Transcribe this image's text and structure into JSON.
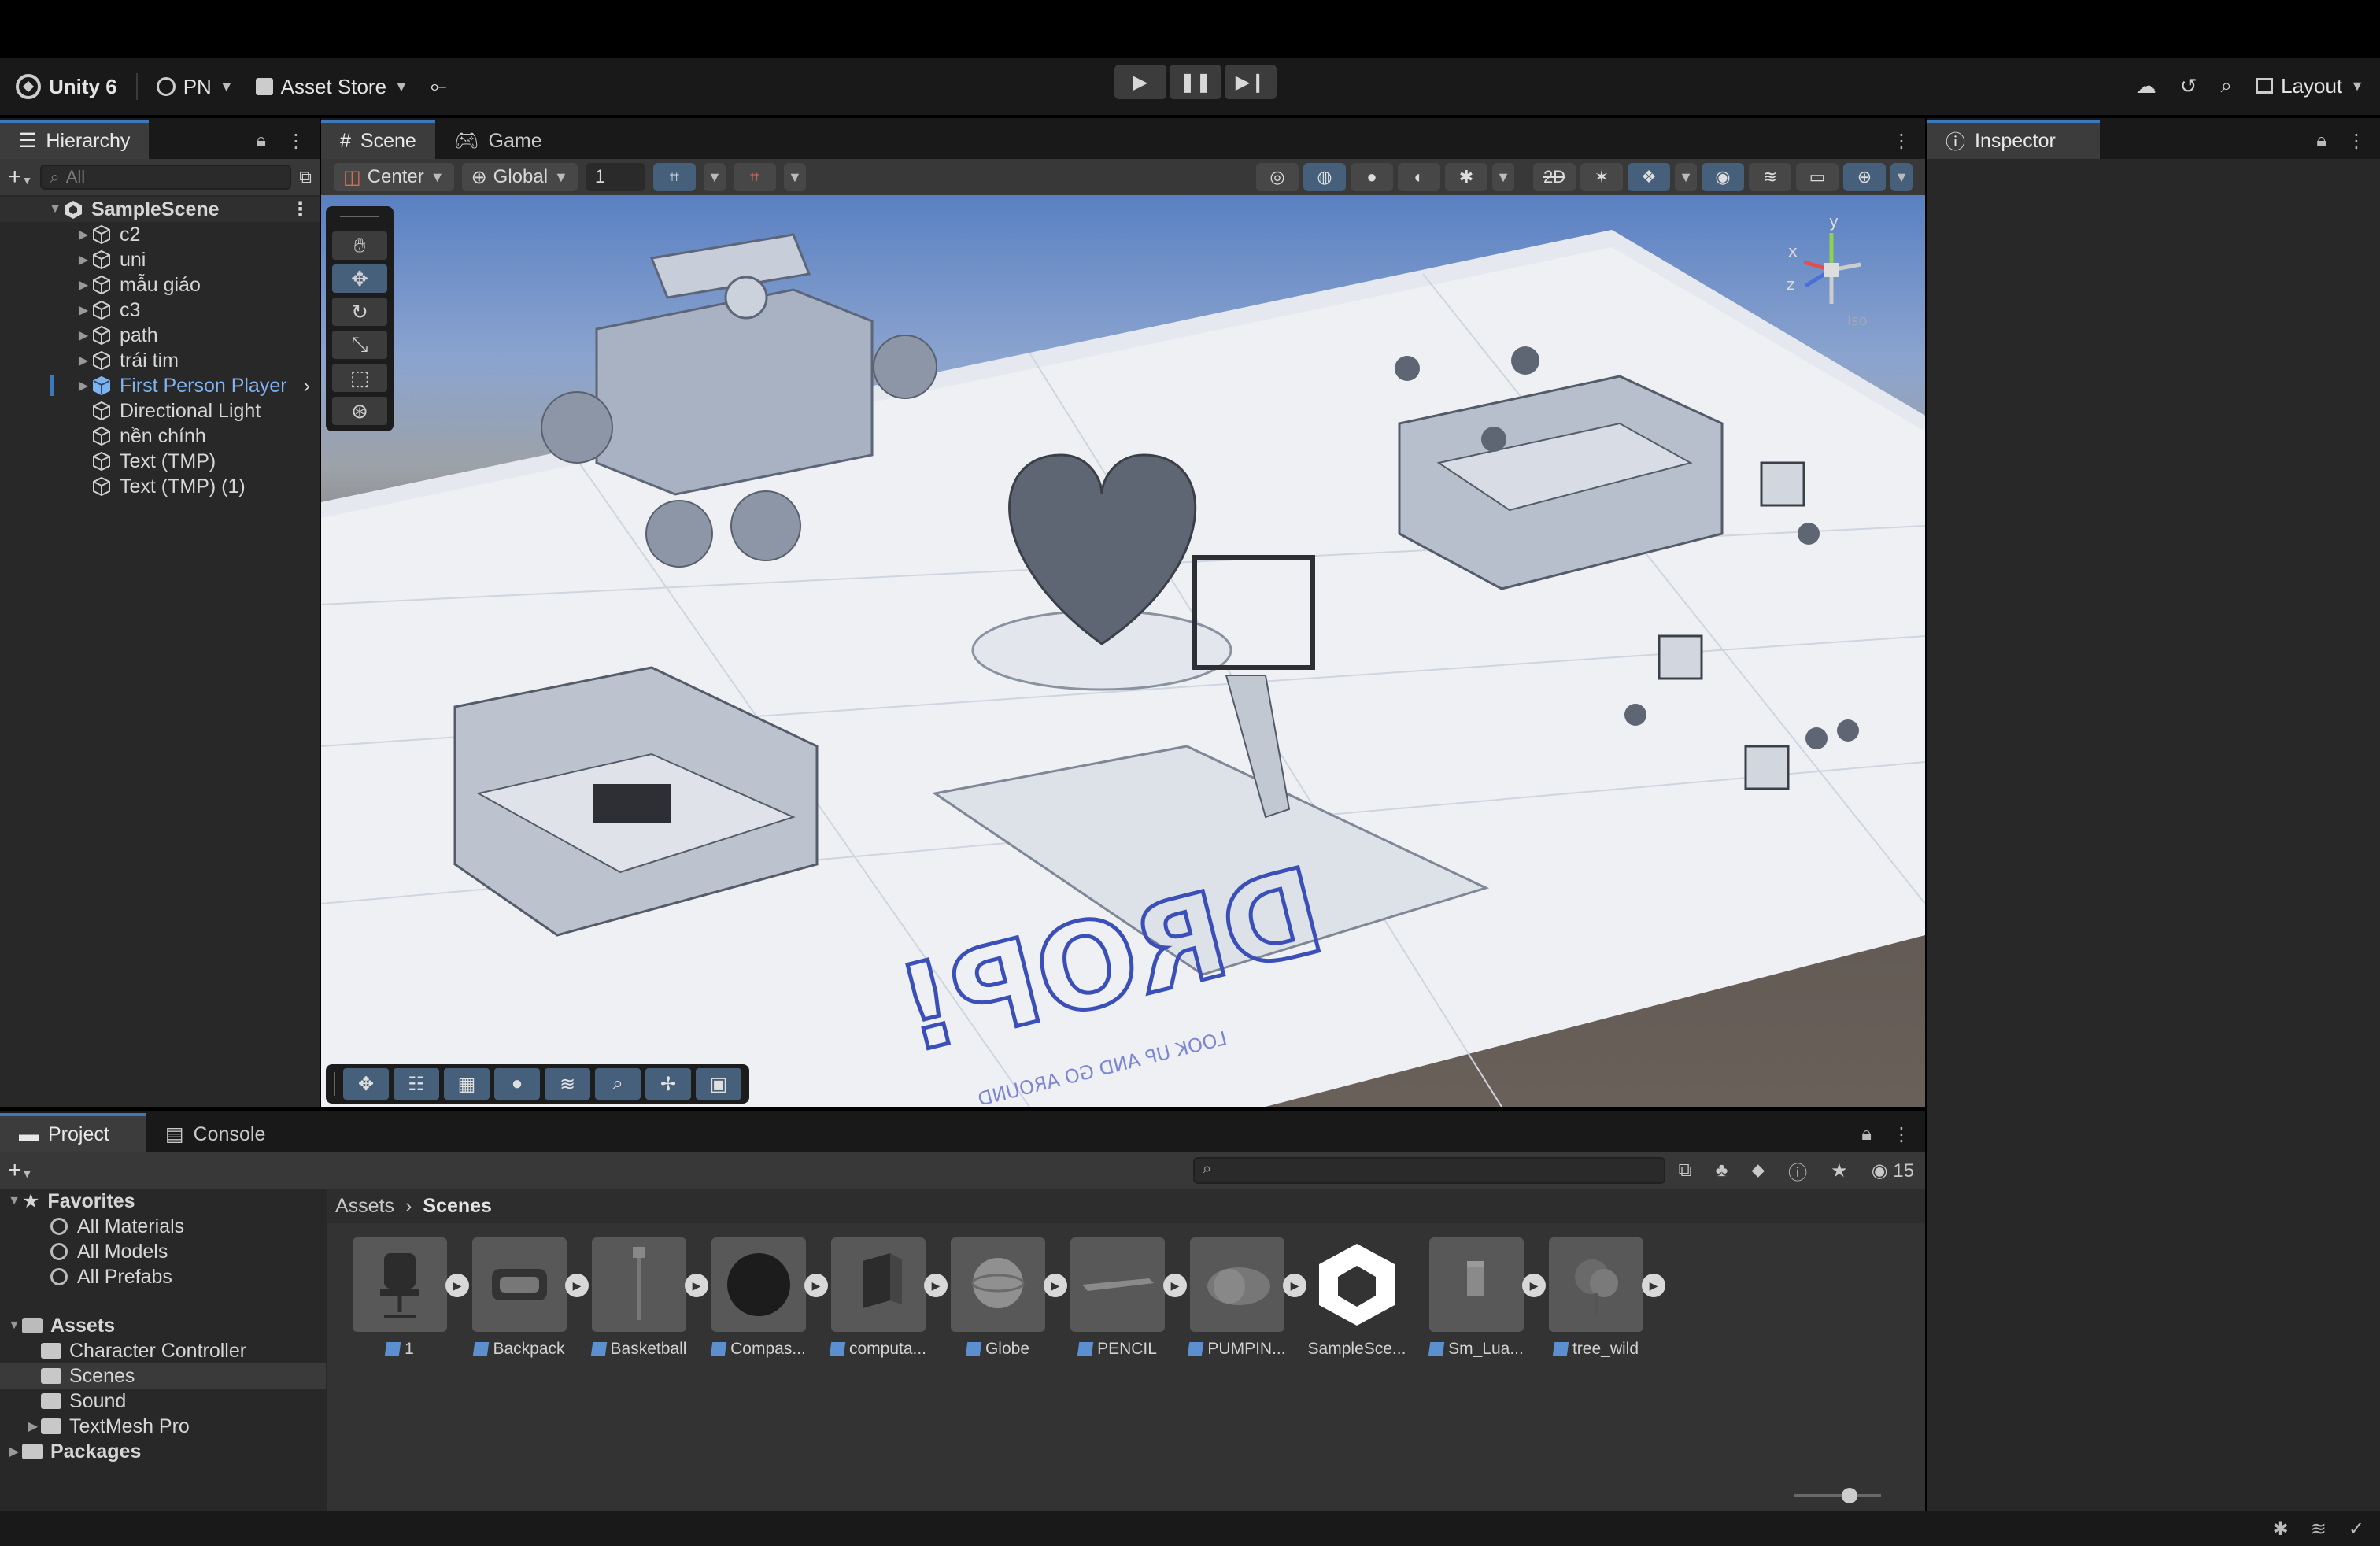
{
  "toolbar": {
    "app_name": "Unity 6",
    "account": "PN",
    "asset_store": "Asset Store",
    "layout": "Layout"
  },
  "hierarchy": {
    "tab_label": "Hierarchy",
    "search_placeholder": "All",
    "scene_name": "SampleScene",
    "items": [
      {
        "label": "c2",
        "has_children": true,
        "selected": false
      },
      {
        "label": "uni",
        "has_children": true,
        "selected": false
      },
      {
        "label": "mẫu giáo",
        "has_children": true,
        "selected": false
      },
      {
        "label": "c3",
        "has_children": true,
        "selected": false
      },
      {
        "label": "path",
        "has_children": true,
        "selected": false
      },
      {
        "label": "trái tim",
        "has_children": true,
        "selected": false
      },
      {
        "label": "First Person Player",
        "has_children": true,
        "selected": true
      },
      {
        "label": "Directional Light",
        "has_children": false,
        "selected": false
      },
      {
        "label": "nền chính",
        "has_children": false,
        "selected": false
      },
      {
        "label": "Text (TMP)",
        "has_children": false,
        "selected": false
      },
      {
        "label": "Text (TMP) (1)",
        "has_children": false,
        "selected": false
      }
    ]
  },
  "scene_view": {
    "tabs": [
      {
        "label": "Scene",
        "icon": "grid-icon",
        "active": true
      },
      {
        "label": "Game",
        "icon": "gamepad-icon",
        "active": false
      }
    ],
    "pivot_mode": "Center",
    "pivot_rotation": "Global",
    "grid_size_value": "1",
    "mode_2d_label": "2D",
    "gizmo_axes": {
      "x": "x",
      "y": "y",
      "z": "z"
    },
    "projection_label": "Iso",
    "floor_text": "DROP!",
    "floor_subtext": "LOOK UP AND GO AROUND"
  },
  "inspector": {
    "tab_label": "Inspector"
  },
  "project": {
    "tabs": [
      {
        "label": "Project",
        "active": true
      },
      {
        "label": "Console",
        "active": false
      }
    ],
    "hidden_count": "15",
    "favorites": {
      "label": "Favorites",
      "items": [
        "All Materials",
        "All Models",
        "All Prefabs"
      ]
    },
    "assets_root": {
      "label": "Assets",
      "folders": [
        {
          "label": "Character Controller",
          "selected": false,
          "expandable": false
        },
        {
          "label": "Scenes",
          "selected": true,
          "expandable": false
        },
        {
          "label": "Sound",
          "selected": false,
          "expandable": false
        },
        {
          "label": "TextMesh Pro",
          "selected": false,
          "expandable": true
        }
      ]
    },
    "packages_label": "Packages",
    "breadcrumb": [
      "Assets",
      "Scenes"
    ],
    "assets": [
      {
        "label": "1",
        "thumb": "office-chair",
        "prefab": true
      },
      {
        "label": "Backpack",
        "thumb": "backpack",
        "prefab": true
      },
      {
        "label": "Basketball",
        "thumb": "hoop",
        "prefab": true
      },
      {
        "label": "Compas...",
        "thumb": "dark-sphere",
        "prefab": true
      },
      {
        "label": "computa...",
        "thumb": "computer",
        "prefab": true
      },
      {
        "label": "Globe",
        "thumb": "globe",
        "prefab": true
      },
      {
        "label": "PENCIL",
        "thumb": "pencil",
        "prefab": true
      },
      {
        "label": "PUMPIN...",
        "thumb": "pumpkin",
        "prefab": true
      },
      {
        "label": "SampleSce...",
        "thumb": "unity-scene",
        "prefab": false
      },
      {
        "label": "Sm_Lua...",
        "thumb": "box",
        "prefab": true
      },
      {
        "label": "tree_wild",
        "thumb": "tree",
        "prefab": true
      }
    ]
  },
  "colors": {
    "accent": "#3a79bb",
    "selected_text": "#7fb3f0",
    "panel_bg": "#282828",
    "toolbar_bg": "#191919"
  }
}
